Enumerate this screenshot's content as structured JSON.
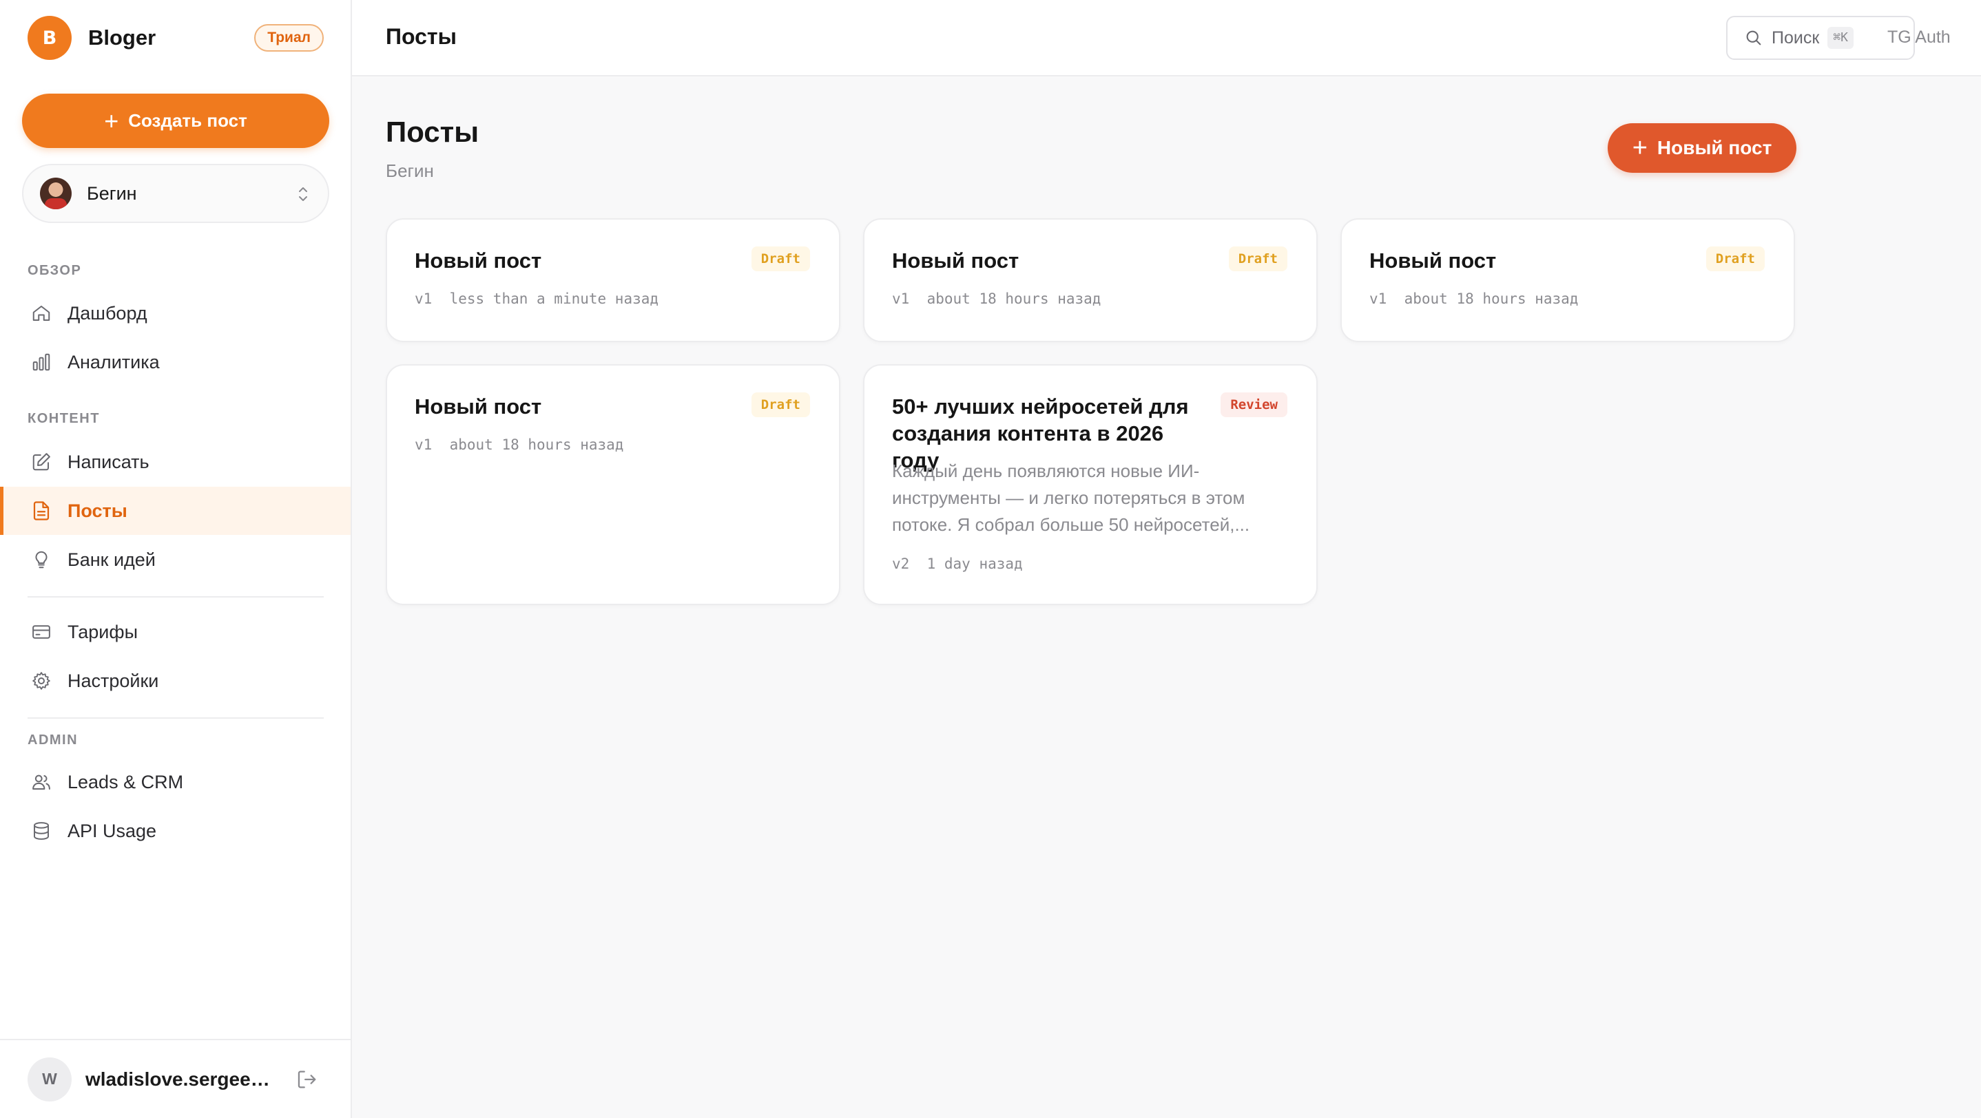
{
  "brand": {
    "logo_letter": "B",
    "name": "Bloger",
    "badge": "Триал"
  },
  "sidebar": {
    "create_label": "Создать пост",
    "blog_selector": {
      "name": "Бегин"
    },
    "sections": [
      {
        "title": "ОБЗОР"
      },
      {
        "title": "КОНТЕНТ"
      },
      {
        "title": "ADMIN"
      }
    ],
    "items": [
      {
        "label": "Дашборд",
        "icon": "home-icon"
      },
      {
        "label": "Аналитика",
        "icon": "bar-chart-icon"
      },
      {
        "label": "Написать",
        "icon": "edit-icon"
      },
      {
        "label": "Посты",
        "icon": "document-icon",
        "active": true
      },
      {
        "label": "Банк идей",
        "icon": "lightbulb-icon"
      },
      {
        "label": "Тарифы",
        "icon": "credit-card-icon"
      },
      {
        "label": "Настройки",
        "icon": "gear-icon"
      },
      {
        "label": "Leads & CRM",
        "icon": "users-icon"
      },
      {
        "label": "API Usage",
        "icon": "database-icon"
      }
    ],
    "user": {
      "initial": "W",
      "name": "wladislove.sergeen..."
    }
  },
  "topbar": {
    "title": "Посты",
    "search": {
      "label": "Поиск",
      "shortcut": "⌘K"
    },
    "tg_auth": "TG Auth"
  },
  "main": {
    "title": "Посты",
    "subtitle": "Бегин",
    "new_post_label": "Новый пост",
    "posts": [
      {
        "title": "Новый пост",
        "status": "Draft",
        "version": "v1",
        "time": "less than a minute назад",
        "excerpt": ""
      },
      {
        "title": "Новый пост",
        "status": "Draft",
        "version": "v1",
        "time": "about 18 hours назад",
        "excerpt": ""
      },
      {
        "title": "Новый пост",
        "status": "Draft",
        "version": "v1",
        "time": "about 18 hours назад",
        "excerpt": ""
      },
      {
        "title": "Новый пост",
        "status": "Draft",
        "version": "v1",
        "time": "about 18 hours назад",
        "excerpt": ""
      },
      {
        "title": "50+ лучших нейросетей для создания контента в 2026 году",
        "status": "Review",
        "version": "v2",
        "time": "1 day назад",
        "excerpt": "Каждый день появляются новые ИИ-инструменты — и легко потеряться в этом потоке. Я собрал больше 50 нейросетей,..."
      }
    ]
  },
  "colors": {
    "accent": "#f07a1e",
    "accent_button": "#e0582c",
    "draft": "#e0a020",
    "review": "#d2452d"
  }
}
